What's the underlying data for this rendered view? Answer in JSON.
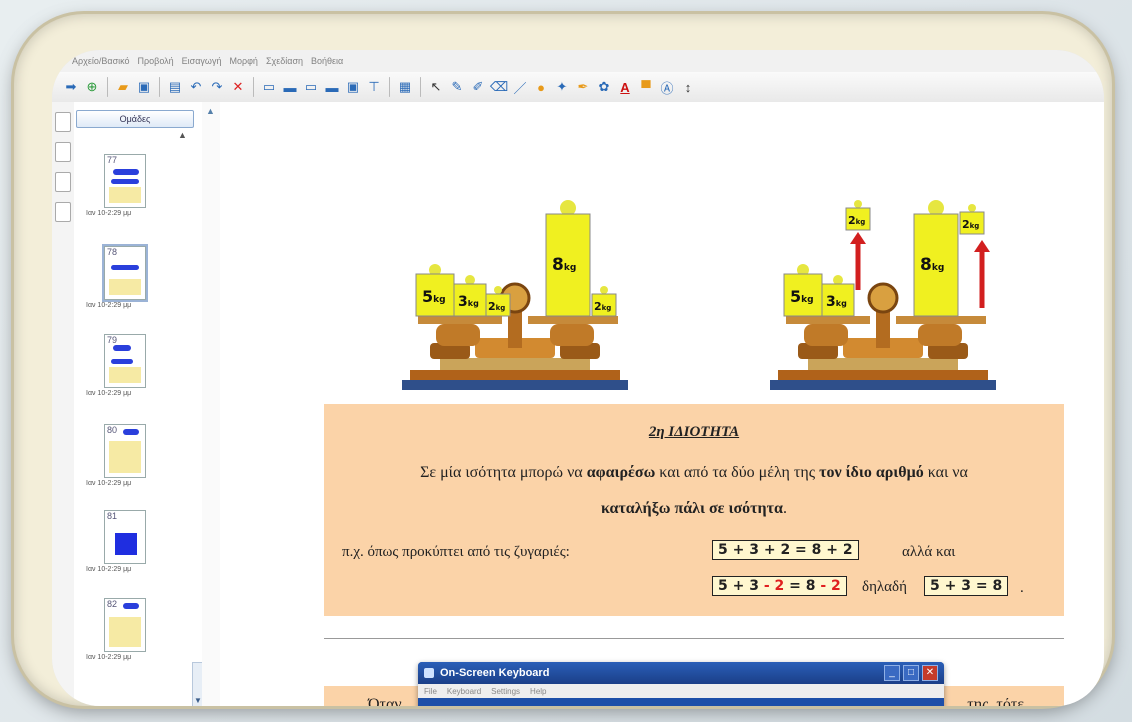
{
  "menubar": {
    "items": [
      "Αρχείο/Βασικό",
      "Προβολή",
      "Εισαγωγή",
      "Μορφή",
      "Σχεδίαση",
      "Βοήθεια"
    ]
  },
  "toolbar": {
    "icons": [
      "arrow-right-icon",
      "add-page-icon",
      "open-folder-icon",
      "save-icon",
      "new-page-icon",
      "undo-icon",
      "redo-icon",
      "delete-icon",
      "screen-shade-icon",
      "display-icon",
      "presentation-icon",
      "screen-capture-icon",
      "image-icon",
      "table-icon",
      "select-pointer-icon",
      "pen-icon",
      "creative-pen-icon",
      "eraser-icon",
      "line-icon",
      "shape-icon",
      "magic-pen-icon",
      "highlighter-icon",
      "fill-icon",
      "text-icon",
      "color-fill-icon",
      "recognition-icon",
      "more-icon"
    ]
  },
  "sidebar": {
    "groups_label": "Ομάδες",
    "thumbnails": [
      {
        "num": "77",
        "label": "Ιαν 10-2:29 μμ"
      },
      {
        "num": "78",
        "label": "Ιαν 10-2:29 μμ"
      },
      {
        "num": "79",
        "label": "Ιαν 10-2:29 μμ"
      },
      {
        "num": "80",
        "label": "Ιαν 10-2:29 μμ"
      },
      {
        "num": "81",
        "label": "Ιαν 10-2:29 μμ"
      },
      {
        "num": "82",
        "label": "Ιαν 10-2:29 μμ"
      }
    ]
  },
  "scales_left": {
    "weights_left": [
      "5",
      "3",
      "2"
    ],
    "weights_right": [
      "8",
      "2"
    ],
    "unit": "kg"
  },
  "scales_right": {
    "weights_left": [
      "5",
      "3"
    ],
    "weights_right": [
      "8"
    ],
    "lifted": [
      "2",
      "2"
    ],
    "unit": "kg"
  },
  "lesson": {
    "title": "2η ΙΔΙΟΤΗΤΑ",
    "line1_a": "Σε μία ισότητα μπορώ να ",
    "line1_b": "αφαιρέσω",
    "line1_c": " και από τα δύο μέλη της ",
    "line1_d": "τον ίδιο αριθμό",
    "line1_e": " και να",
    "line2_a": "καταλήξω πάλι σε ισότητα",
    "line2_b": ".",
    "example": "π.χ.  όπως προκύπτει από τις ζυγαριές:",
    "eq1": "5 + 3 + 2 = 8 + 2",
    "also": "αλλά και",
    "eq2_a": "5 + 3 ",
    "eq2_b": "- 2",
    "eq2_c": " = 8 ",
    "eq2_d": "- 2",
    "meaning": "δηλαδή",
    "eq3": "5 + 3 = 8",
    "end": "."
  },
  "panel2": {
    "left": "Όταν",
    "right": "της, τότε"
  },
  "osk": {
    "title": "On-Screen Keyboard",
    "menu": [
      "File",
      "Keyboard",
      "Settings",
      "Help"
    ]
  }
}
